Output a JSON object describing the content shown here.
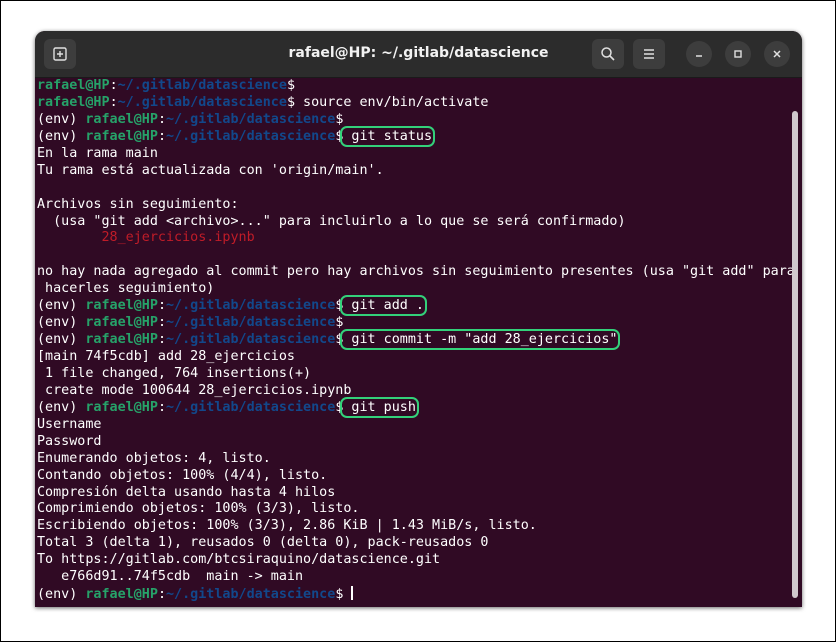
{
  "window": {
    "title": "rafael@HP: ~/.gitlab/datascience"
  },
  "colors": {
    "background": "#300a24",
    "prompt_user": "#26a269",
    "prompt_path": "#12488b",
    "untracked_file": "#c01c28",
    "highlight": "#33d17a"
  },
  "icons": {
    "new_tab": "new-tab-icon",
    "search": "search-icon",
    "menu": "hamburger-menu-icon",
    "minimize": "minimize-icon",
    "maximize": "maximize-icon",
    "close": "close-icon"
  },
  "prompt": {
    "env": "(env) ",
    "user": "rafael@HP",
    "colon": ":",
    "path": "~/.gitlab/datascience",
    "dollar": "$"
  },
  "lines": [
    {
      "env": false,
      "cmd": ""
    },
    {
      "env": false,
      "cmd": " source env/bin/activate"
    },
    {
      "env": true,
      "cmd": ""
    },
    {
      "env": true,
      "cmd": " git status",
      "highlight": true
    },
    "En la rama main",
    "Tu rama está actualizada con 'origin/main'.",
    "",
    "Archivos sin seguimiento:",
    "  (usa \"git add <archivo>...\" para incluirlo a lo que se será confirmado)",
    {
      "untracked": "        28_ejercicios.ipynb"
    },
    "",
    "no hay nada agregado al commit pero hay archivos sin seguimiento presentes (usa \"git add\" para",
    " hacerles seguimiento)",
    {
      "env": true,
      "cmd": " git add .",
      "highlight": true
    },
    {
      "env": true,
      "cmd": ""
    },
    {
      "env": true,
      "cmd": " git commit -m \"add 28_ejercicios\"",
      "highlight": true
    },
    "[main 74f5cdb] add 28_ejercicios",
    " 1 file changed, 764 insertions(+)",
    " create mode 100644 28_ejercicios.ipynb",
    {
      "env": true,
      "cmd": " git push",
      "highlight": true
    },
    "Username",
    "Password",
    "Enumerando objetos: 4, listo.",
    "Contando objetos: 100% (4/4), listo.",
    "Compresión delta usando hasta 4 hilos",
    "Comprimiendo objetos: 100% (3/3), listo.",
    "Escribiendo objetos: 100% (3/3), 2.86 KiB | 1.43 MiB/s, listo.",
    "Total 3 (delta 1), reusados 0 (delta 0), pack-reusados 0",
    "To https://gitlab.com/btcsiraquino/datascience.git",
    "   e766d91..74f5cdb  main -> main",
    {
      "env": true,
      "cmd": " ",
      "cursor": true
    }
  ]
}
